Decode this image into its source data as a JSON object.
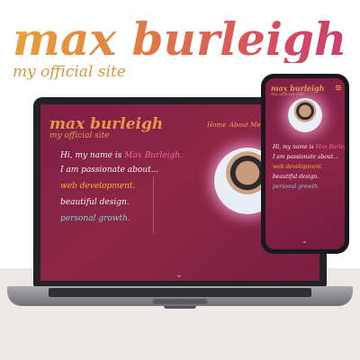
{
  "brand": {
    "title": "max burleigh",
    "subtitle": "my official site"
  },
  "site": {
    "logo": "max burleigh",
    "logo_sub": "my official site",
    "nav": [
      "Home",
      "About Me"
    ],
    "greeting_prefix": "Hi, my name is ",
    "greeting_name": "Max Burleigh.",
    "passion": "I am passionate about...",
    "interests": [
      {
        "label": "web development.",
        "color": "#f0b83a"
      },
      {
        "label": "beautiful design.",
        "color": "#f4f4f4"
      },
      {
        "label": "personal growth.",
        "color": "#7fd0d8"
      }
    ],
    "name_color": "#f06aa0",
    "scroll_icon": "chevron-down-icon"
  },
  "colors": {
    "brand_gradient_start": "#e8a13c",
    "brand_gradient_end": "#c8406b",
    "screen_background": "#8a2446",
    "portrait_glow": "#f6a0d2"
  }
}
